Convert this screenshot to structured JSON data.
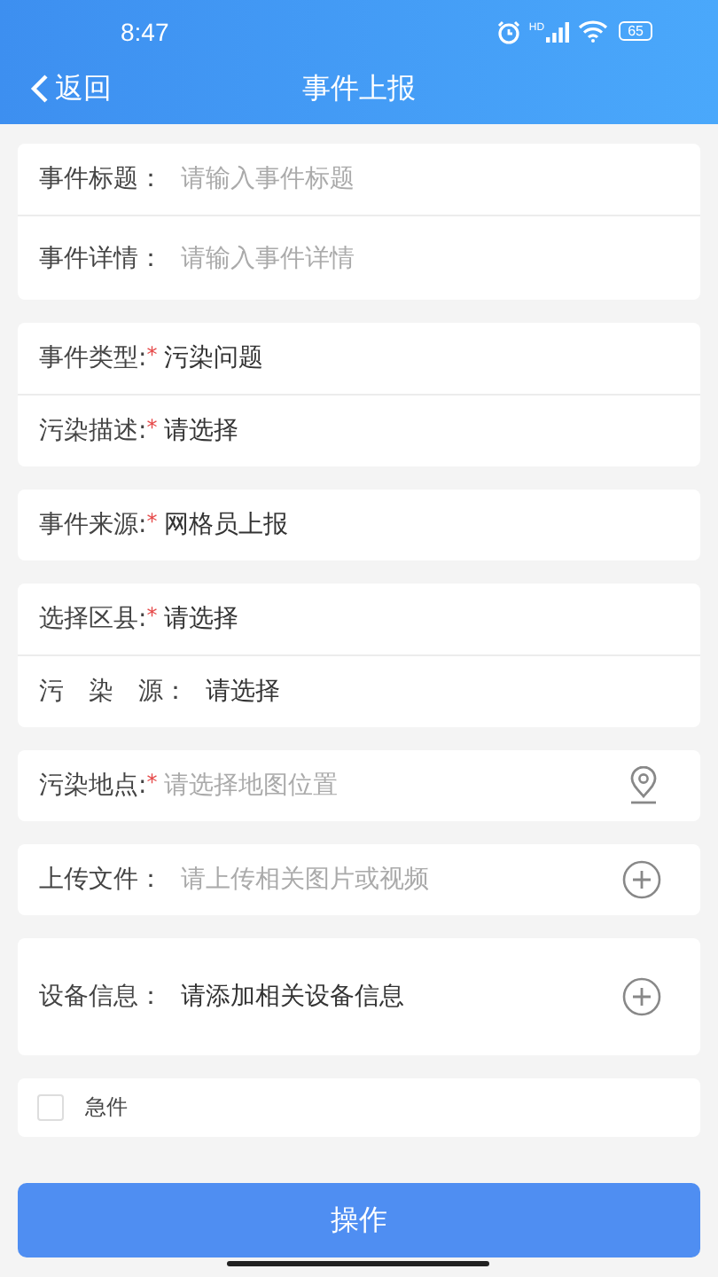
{
  "status_bar": {
    "time": "8:47",
    "network": "HD",
    "battery": "65"
  },
  "nav": {
    "back": "返回",
    "title": "事件上报"
  },
  "groups": [
    {
      "rows": [
        {
          "kind": "input",
          "label": "事件标题：",
          "placeholder": "请输入事件标题"
        },
        {
          "kind": "textarea",
          "label": "事件详情：",
          "placeholder": "请输入事件详情"
        }
      ]
    },
    {
      "rows": [
        {
          "kind": "select",
          "label": "事件类型:",
          "mark": "*",
          "value": "污染问题"
        },
        {
          "kind": "select",
          "label": "污染描述:",
          "mark": "*",
          "value": "请选择"
        }
      ]
    },
    {
      "rows": [
        {
          "kind": "select",
          "label": "事件来源:",
          "mark": "*",
          "value": "网格员上报"
        }
      ]
    },
    {
      "rows": [
        {
          "kind": "select",
          "label": "选择区县:",
          "mark": "*",
          "value": "请选择"
        },
        {
          "kind": "select",
          "label": "污　染　源：",
          "value": "请选择"
        }
      ]
    },
    {
      "rows": [
        {
          "kind": "location",
          "label": "污染地点:",
          "mark": "*",
          "placeholder": "请选择地图位置"
        }
      ]
    },
    {
      "rows": [
        {
          "kind": "upload",
          "label": "上传文件：",
          "placeholder": "请上传相关图片或视频"
        }
      ]
    },
    {
      "rows": [
        {
          "kind": "device",
          "label": "设备信息：",
          "value": "请添加相关设备信息"
        }
      ]
    }
  ],
  "urgent": {
    "label": "急件",
    "checked": false
  },
  "submit": "操作"
}
